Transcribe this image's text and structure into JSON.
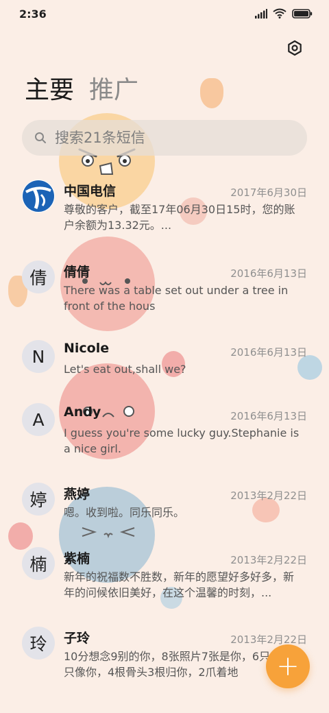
{
  "status": {
    "time": "2:36"
  },
  "tabs": [
    {
      "label": "主要",
      "active": true
    },
    {
      "label": "推广",
      "active": false
    }
  ],
  "search": {
    "placeholder": "搜索21条短信"
  },
  "icons": {
    "settings": "settings-icon",
    "search": "search-icon",
    "compose": "plus-icon"
  },
  "colors": {
    "background": "#fbeee6",
    "fab": "#f7a23a",
    "telecom_blue": "#1b63b6"
  },
  "conversations": [
    {
      "avatar": "",
      "avatar_type": "china-telecom-logo",
      "name": "中国电信",
      "date": "2017年6月30日",
      "preview": "尊敬的客户，截至17年06月30日15时，您的账户余额为13.32元。..."
    },
    {
      "avatar": "倩",
      "name": "倩倩",
      "date": "2016年6月13日",
      "preview": "There was a table set out under a tree in front of the hous"
    },
    {
      "avatar": "N",
      "name": "Nicole",
      "date": "2016年6月13日",
      "preview": "Let's eat out,shall we?"
    },
    {
      "avatar": "A",
      "name": "Andy",
      "date": "2016年6月13日",
      "preview": "I guess you're some lucky guy.Stephanie is a nice girl."
    },
    {
      "avatar": "婷",
      "name": "燕婷",
      "date": "2013年2月22日",
      "preview": "嗯。收到啦。同乐同乐。"
    },
    {
      "avatar": "楠",
      "name": "紫楠",
      "date": "2013年2月22日",
      "preview": "新年的祝福数不胜数，新年的愿望好多好多，新年的问候依旧美好，在这个温馨的时刻，..."
    },
    {
      "avatar": "玲",
      "name": "子玲",
      "date": "2013年2月22日",
      "preview": "10分想念9别的你，8张照片7张是你，6只小狗5只像你，4根骨头3根归你，2爪着地"
    }
  ],
  "fab": {
    "label": "+"
  }
}
